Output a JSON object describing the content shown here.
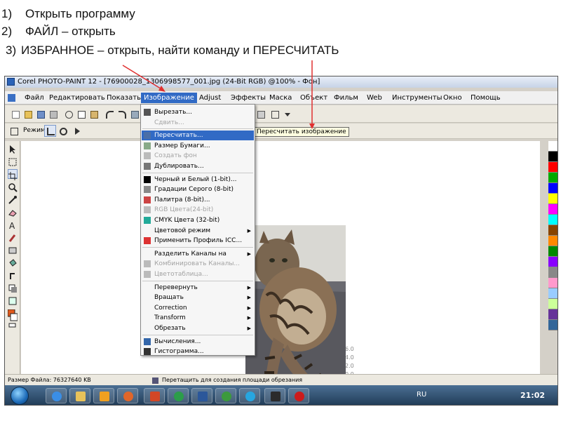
{
  "instructions": [
    {
      "num": "1)",
      "text": "Открыть программу"
    },
    {
      "num": "2)",
      "text": "ФАЙЛ – открыть"
    },
    {
      "num": "3)",
      "text": "ИЗБРАННОЕ – открыть, найти команду и ПЕРЕСЧИТАТЬ"
    }
  ],
  "window": {
    "title": "Corel PHOTO-PAINT 12 - [76900028_1306998577_001.jpg (24-Bit RGB) @100% - Фон]"
  },
  "menubar": [
    "Файл",
    "Редактировать",
    "Показать",
    "Изображение",
    "Adjust",
    "Эффекты",
    "Маска",
    "Объект",
    "Фильм",
    "Web",
    "Инструменты",
    "Окно",
    "Помощь"
  ],
  "menubar_active": "Изображение",
  "toolbar2": {
    "mode_label": "Режим"
  },
  "tooltip": "Пересчитать изображение",
  "dropdown": {
    "items": [
      {
        "label": "Вырезать...",
        "icon": "scissors-icon",
        "state": "normal",
        "submenu": false
      },
      {
        "label": "Сдвить...",
        "icon": "",
        "state": "disabled",
        "submenu": false
      },
      {
        "label": "Пересчитать...",
        "icon": "resample-icon",
        "state": "highlight",
        "submenu": false
      },
      {
        "label": "Размер Бумаги...",
        "icon": "paper-size-icon",
        "state": "normal",
        "submenu": false
      },
      {
        "label": "Создать фон",
        "icon": "create-background-icon",
        "state": "disabled",
        "submenu": false
      },
      {
        "label": "Дублировать...",
        "icon": "duplicate-icon",
        "state": "normal",
        "submenu": false
      },
      {
        "label": "Черный и Белый (1-bit)...",
        "icon": "black-white-icon",
        "state": "normal",
        "submenu": false
      },
      {
        "label": "Градации Серого (8-bit)",
        "icon": "grayscale-icon",
        "state": "normal",
        "submenu": false
      },
      {
        "label": "Палитра (8-bit)...",
        "icon": "palette-icon",
        "state": "normal",
        "submenu": false
      },
      {
        "label": "RGB Цвета(24-bit)",
        "icon": "rgb-icon",
        "state": "disabled",
        "submenu": false
      },
      {
        "label": "CMYK Цвета (32-bit)",
        "icon": "cmyk-icon",
        "state": "normal",
        "submenu": false
      },
      {
        "label": "Цветовой режим",
        "icon": "",
        "state": "normal",
        "submenu": true
      },
      {
        "label": "Применить Профиль ICC...",
        "icon": "icc-profile-icon",
        "state": "normal",
        "submenu": false
      },
      {
        "label": "Разделить Каналы на",
        "icon": "",
        "state": "normal",
        "submenu": true
      },
      {
        "label": "Комбинировать Каналы...",
        "icon": "combine-channels-icon",
        "state": "disabled",
        "submenu": false
      },
      {
        "label": "Цветотаблица...",
        "icon": "color-table-icon",
        "state": "disabled",
        "submenu": false
      },
      {
        "label": "Перевернуть",
        "icon": "",
        "state": "normal",
        "submenu": true
      },
      {
        "label": "Вращать",
        "icon": "",
        "state": "normal",
        "submenu": true
      },
      {
        "label": "Correction",
        "icon": "",
        "state": "normal",
        "submenu": true
      },
      {
        "label": "Transform",
        "icon": "",
        "state": "normal",
        "submenu": true
      },
      {
        "label": "Обрезать",
        "icon": "",
        "state": "normal",
        "submenu": true
      },
      {
        "label": "Вычисления...",
        "icon": "calculations-icon",
        "state": "normal",
        "submenu": false
      },
      {
        "label": "Гистограмма...",
        "icon": "histogram-icon",
        "state": "normal",
        "submenu": false
      }
    ]
  },
  "statusbar": {
    "file_size": "Размер Файла: 76327640 KB",
    "hint": "Перетащить для создания площади обрезания"
  },
  "histogram_labels": [
    "6.0",
    "4.0",
    "2.0",
    "0.0"
  ],
  "taskbar": {
    "lang": "RU",
    "clock": "21:02"
  },
  "colors": {
    "highlight": "#316ac5",
    "fg_swatch": "#e25a1c",
    "arrow": "#e03030"
  },
  "palette": [
    "#ffffff",
    "#000000",
    "#ff0000",
    "#00aa00",
    "#0000ff",
    "#ffff00",
    "#ff00ff",
    "#00ffff",
    "#884400",
    "#ff8800",
    "#008800",
    "#8800ff",
    "#888888",
    "#ff99cc",
    "#99ccff",
    "#ccff99",
    "#663399",
    "#336699"
  ]
}
